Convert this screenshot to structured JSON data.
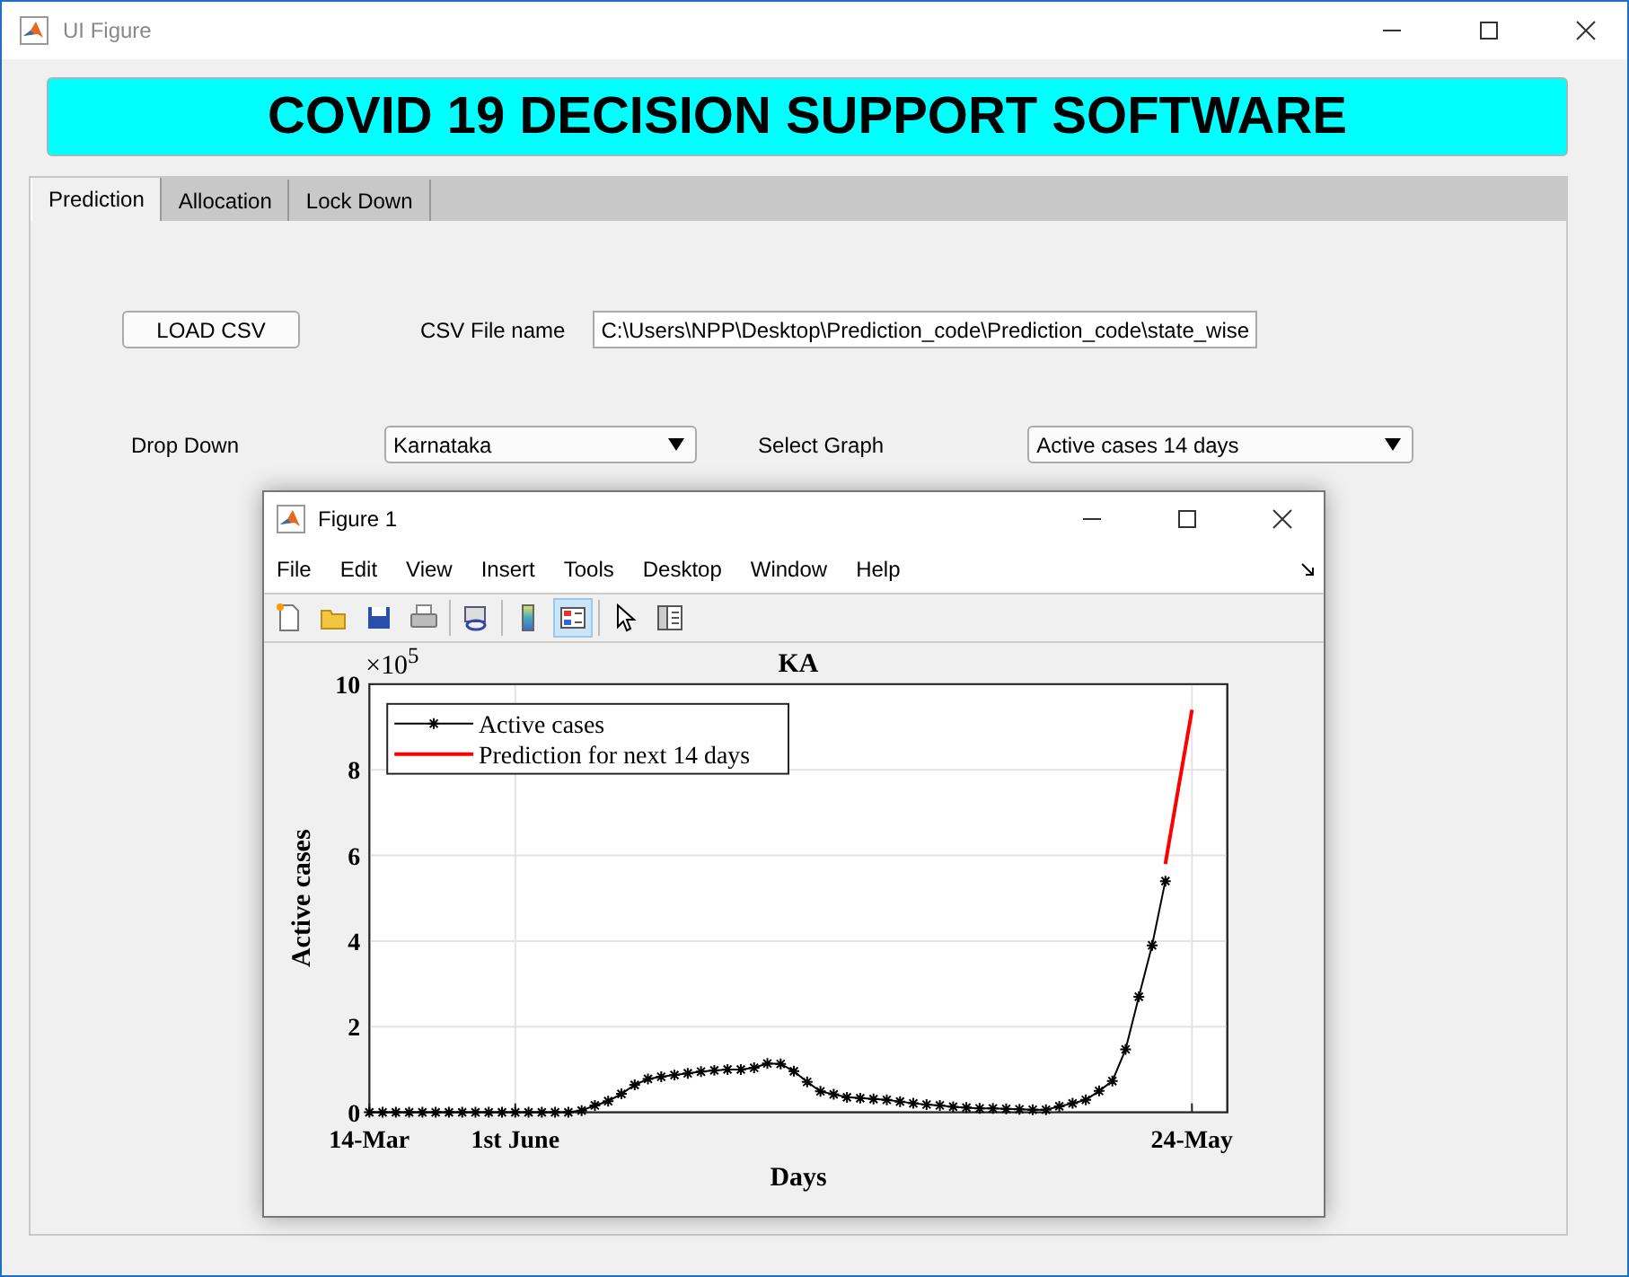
{
  "window": {
    "title": "UI Figure"
  },
  "header": {
    "title": "COVID 19 DECISION SUPPORT SOFTWARE"
  },
  "tabs": [
    {
      "label": "Prediction",
      "selected": true
    },
    {
      "label": "Allocation",
      "selected": false
    },
    {
      "label": "Lock Down",
      "selected": false
    }
  ],
  "form": {
    "load_button": "LOAD CSV",
    "file_label": "CSV File name",
    "file_path": "C:\\Users\\NPP\\Desktop\\Prediction_code\\Prediction_code\\state_wise",
    "dropdown_label": "Drop Down",
    "dropdown_value": "Karnataka",
    "graph_label": "Select Graph",
    "graph_value": "Active cases 14 days"
  },
  "figure": {
    "title": "Figure 1",
    "menu": [
      "File",
      "Edit",
      "View",
      "Insert",
      "Tools",
      "Desktop",
      "Window",
      "Help"
    ],
    "toolbar": [
      {
        "kind": "new",
        "selected": false
      },
      {
        "kind": "open",
        "selected": false
      },
      {
        "kind": "save",
        "selected": false
      },
      {
        "kind": "print",
        "selected": false
      },
      {
        "kind": "link",
        "selected": false
      },
      {
        "kind": "colorbar",
        "selected": false
      },
      {
        "kind": "legend",
        "selected": true
      },
      {
        "kind": "pointer",
        "selected": false
      },
      {
        "kind": "inspector",
        "selected": false
      }
    ],
    "chart_data": {
      "type": "line",
      "grid": true,
      "legend": "upper left",
      "title": "KA",
      "xlabel": "Days",
      "ylabel": "Active cases",
      "ylim": [
        0,
        10
      ],
      "yticks": [
        0,
        2,
        4,
        6,
        8,
        10
      ],
      "categories": [
        "14-Mar",
        null,
        null,
        null,
        null,
        null,
        null,
        null,
        null,
        null,
        null,
        "1st June",
        null,
        null,
        null,
        null,
        null,
        null,
        null,
        null,
        null,
        null,
        null,
        null,
        null,
        null,
        null,
        null,
        null,
        null,
        null,
        null,
        null,
        null,
        null,
        null,
        null,
        null,
        null,
        null,
        null,
        null,
        null,
        null,
        null,
        null,
        null,
        null,
        null,
        null,
        null,
        null,
        null,
        null,
        null,
        null,
        null,
        null,
        null,
        null,
        null,
        null,
        "24-May"
      ],
      "series": [
        {
          "name": "Active cases",
          "color": "#000000",
          "marker": "cross",
          "values": [
            0,
            0,
            0,
            0,
            0,
            0,
            0,
            0,
            0,
            0,
            0,
            0,
            0,
            0,
            0,
            0,
            0.04,
            0.16,
            0.26,
            0.43,
            0.64,
            0.78,
            0.83,
            0.87,
            0.91,
            0.95,
            0.98,
            1.0,
            1.0,
            1.04,
            1.14,
            1.13,
            0.96,
            0.71,
            0.49,
            0.42,
            0.35,
            0.33,
            0.31,
            0.29,
            0.25,
            0.21,
            0.18,
            0.16,
            0.13,
            0.11,
            0.09,
            0.09,
            0.08,
            0.07,
            0.06,
            0.06,
            0.14,
            0.21,
            0.29,
            0.5,
            0.73,
            1.47,
            2.7,
            3.9,
            5.4,
            null,
            null
          ]
        },
        {
          "name": "Prediction for next 14 days",
          "color": "#ff0000",
          "values": [
            null,
            null,
            null,
            null,
            null,
            null,
            null,
            null,
            null,
            null,
            null,
            null,
            null,
            null,
            null,
            null,
            null,
            null,
            null,
            null,
            null,
            null,
            null,
            null,
            null,
            null,
            null,
            null,
            null,
            null,
            null,
            null,
            null,
            null,
            null,
            null,
            null,
            null,
            null,
            null,
            null,
            null,
            null,
            null,
            null,
            null,
            null,
            null,
            null,
            null,
            null,
            null,
            null,
            null,
            null,
            null,
            null,
            null,
            null,
            null,
            5.8,
            7.6,
            9.4
          ]
        }
      ],
      "annotations": [
        {
          "text": "×10$^{5}$"
        }
      ]
    }
  }
}
